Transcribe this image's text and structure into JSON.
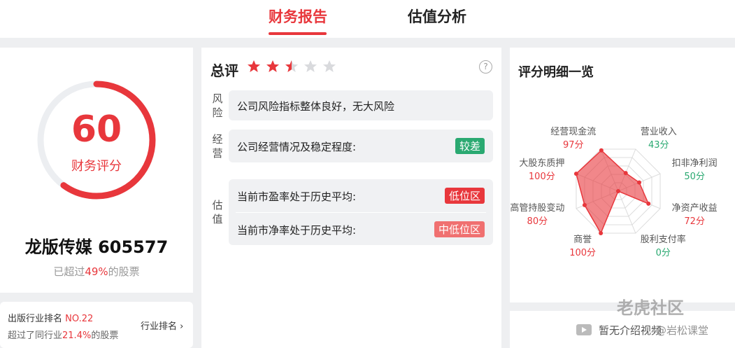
{
  "tabs": {
    "financial_report": "财务报告",
    "valuation_analysis": "估值分析"
  },
  "score_card": {
    "score": "60",
    "score_fraction": 0.6,
    "score_label": "财务评分",
    "stock_name": "龙版传媒 605577",
    "exceed_prefix": "已超过",
    "exceed_value": "49%",
    "exceed_suffix": "的股票"
  },
  "industry_rank": {
    "line1_prefix": "出版行业排名 ",
    "line1_rank": "NO.22",
    "line2_prefix": "超过了同行业",
    "line2_value": "21.4%",
    "line2_suffix": "的股票",
    "button_label": "行业排名",
    "button_chevron": "›"
  },
  "overall": {
    "title": "总评",
    "rating": 2.5,
    "max_rating": 5,
    "help_icon": "?",
    "risk_label": "风险",
    "risk_text": "公司风险指标整体良好，无大风险",
    "operation_label": "经营",
    "operation_text": "公司经营情况及稳定程度:",
    "operation_badge": "较差",
    "valuation_label": "估值",
    "pe_text": "当前市盈率处于历史平均:",
    "pe_badge": "低位区",
    "pb_text": "当前市净率处于历史平均:",
    "pb_badge": "中低位区"
  },
  "radar": {
    "title": "评分明细一览",
    "items": [
      {
        "label": "营业收入",
        "value": "43分",
        "score": 43,
        "color": "#2aa971"
      },
      {
        "label": "扣非净利润",
        "value": "50分",
        "score": 50,
        "color": "#2aa971"
      },
      {
        "label": "净资产收益",
        "value": "72分",
        "score": 72,
        "color": "#e8373c"
      },
      {
        "label": "股利支付率",
        "value": "0分",
        "score": 0,
        "color": "#2aa971"
      },
      {
        "label": "商誉",
        "value": "100分",
        "score": 100,
        "color": "#e8373c"
      },
      {
        "label": "高管持股变动",
        "value": "80分",
        "score": 80,
        "color": "#e8373c"
      },
      {
        "label": "大股东质押",
        "value": "100分",
        "score": 100,
        "color": "#e8373c"
      },
      {
        "label": "经营现金流",
        "value": "97分",
        "score": 97,
        "color": "#e8373c"
      }
    ]
  },
  "video": {
    "text": "暂无介绍视频"
  },
  "watermarks": {
    "community": "老虎社区",
    "classroom": "@岩松课堂"
  },
  "colors": {
    "accent": "#e8373c",
    "green": "#2aa971",
    "badge_light_red": "#f07070"
  }
}
